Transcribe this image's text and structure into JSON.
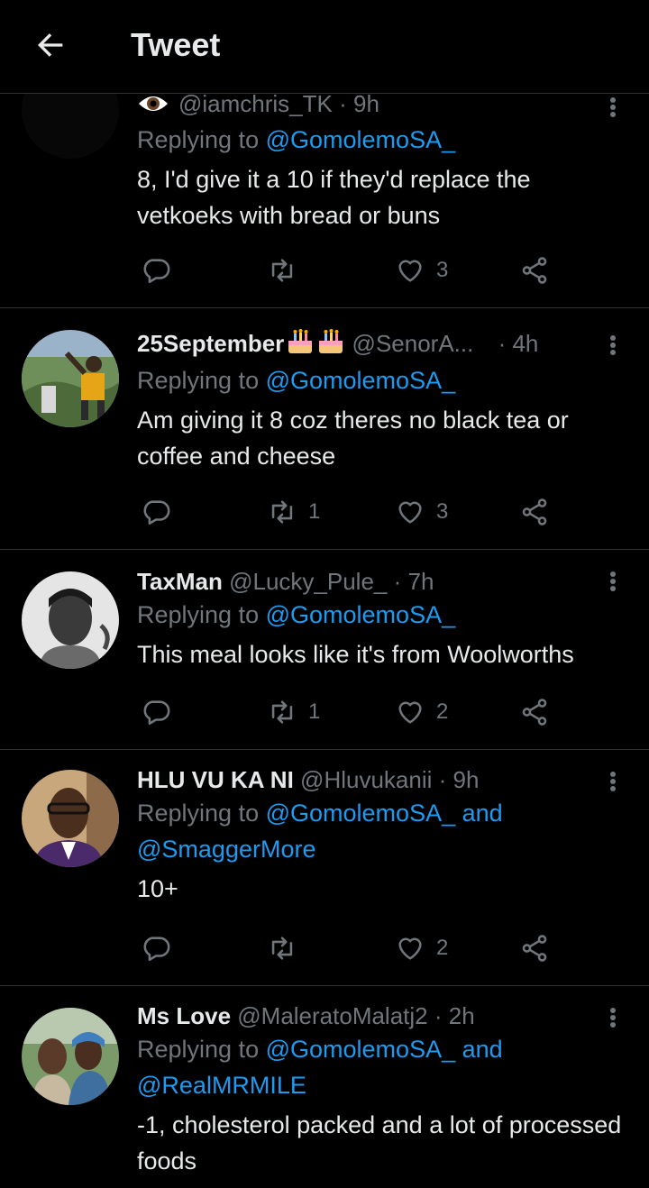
{
  "header": {
    "title": "Tweet"
  },
  "tweets": [
    {
      "name": "",
      "handle": "@iamchris_TK",
      "time": "· 9h",
      "reply_prefix": "Replying to",
      "reply_to": "@GomolemoSA_",
      "reply_and": "",
      "reply_to2": "",
      "text": "8, I'd give it a 10 if they'd replace the vetkoeks with bread or buns",
      "replies": "",
      "retweets": "",
      "likes": "3"
    },
    {
      "name": "25September",
      "handle": "@SenorA...",
      "time": "· 4h",
      "reply_prefix": "Replying to",
      "reply_to": "@GomolemoSA_",
      "reply_and": "",
      "reply_to2": "",
      "text": "Am giving it 8 coz theres no black tea or coffee and cheese",
      "replies": "",
      "retweets": "1",
      "likes": "3"
    },
    {
      "name": "TaxMan",
      "handle": "@Lucky_Pule_",
      "time": "· 7h",
      "reply_prefix": "Replying to",
      "reply_to": "@GomolemoSA_",
      "reply_and": "",
      "reply_to2": "",
      "text": "This meal looks like it's from Woolworths",
      "replies": "",
      "retweets": "1",
      "likes": "2"
    },
    {
      "name": "HLU VU KA NI",
      "handle": "@Hluvukanii",
      "time": "· 9h",
      "reply_prefix": "Replying to",
      "reply_to": "@GomolemoSA_",
      "reply_and": "and",
      "reply_to2": "@SmaggerMore",
      "text": "10+",
      "replies": "",
      "retweets": "",
      "likes": "2"
    },
    {
      "name": "Ms Love",
      "handle": "@MaleratoMalatj2",
      "time": "· 2h",
      "reply_prefix": "Replying to",
      "reply_to": "@GomolemoSA_",
      "reply_and": "and",
      "reply_to2": "@RealMRMILE",
      "text": "-1, cholesterol packed and a lot of processed foods",
      "replies": "",
      "retweets": "",
      "likes": ""
    }
  ],
  "colors": {
    "background": "#000000",
    "text": "#e7e9ea",
    "muted": "#71767b",
    "link": "#1d9bf0",
    "divider": "#2f3336"
  }
}
